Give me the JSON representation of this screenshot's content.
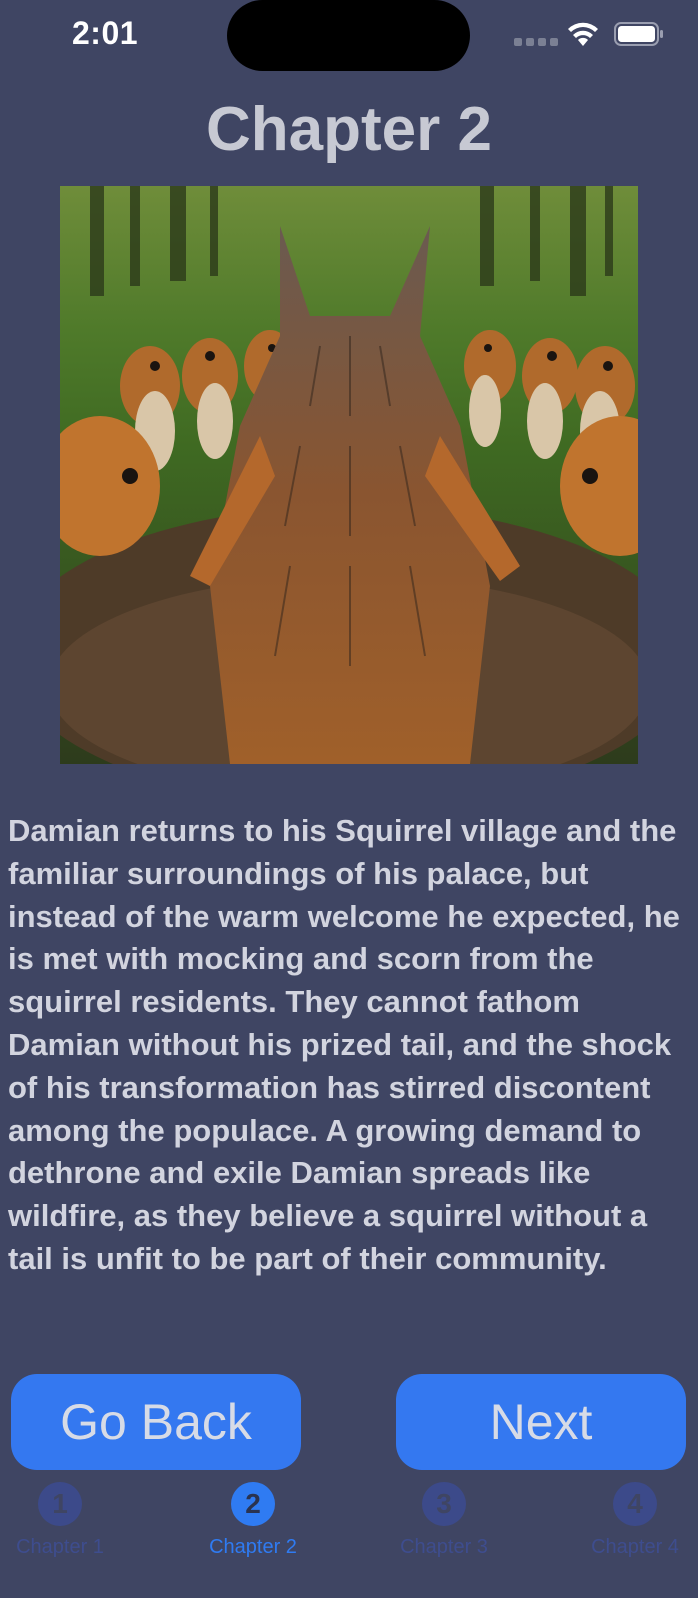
{
  "status": {
    "time": "2:01"
  },
  "chapter_title": "Chapter 2",
  "story_text": "Damian returns to his Squirrel village and the familiar surroundings of his palace, but instead of the warm welcome he expected, he is met with mocking and scorn from the squirrel residents. They cannot fathom Damian without his prized tail, and the shock of his transformation has stirred discontent among the populace. A growing demand to dethrone and exile Damian spreads like wildfire, as they believe a squirrel without a tail is unfit to be part of their community.",
  "buttons": {
    "back": "Go Back",
    "next": "Next"
  },
  "tabs": [
    {
      "number": "1",
      "label": "Chapter 1"
    },
    {
      "number": "2",
      "label": "Chapter 2"
    },
    {
      "number": "3",
      "label": "Chapter 3"
    },
    {
      "number": "4",
      "label": "Chapter 4"
    }
  ],
  "colors": {
    "background": "#3f4563",
    "accent": "#3478f0",
    "inactive_tab": "#3c4a8a"
  }
}
